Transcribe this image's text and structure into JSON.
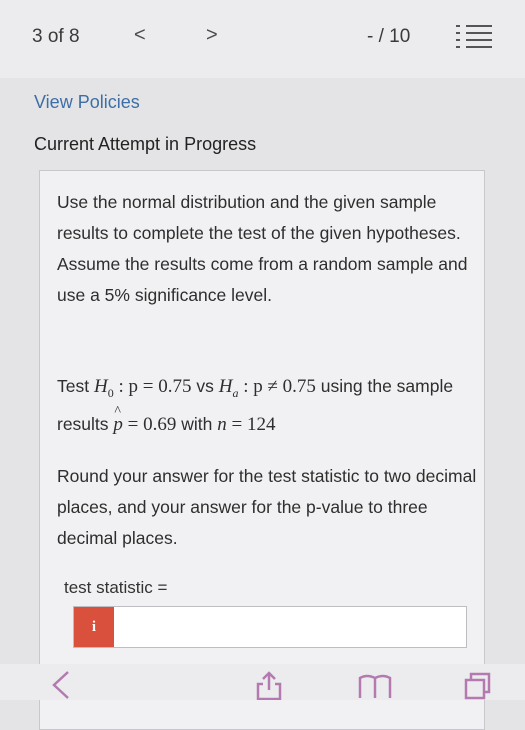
{
  "topbar": {
    "page_indicator": "3 of 8",
    "prev_symbol": "<",
    "next_symbol": ">",
    "score": "- / 10"
  },
  "links": {
    "view_policies": "View Policies"
  },
  "heading": {
    "attempt": "Current Attempt in Progress"
  },
  "question": {
    "instructions": "Use the normal distribution and the given sample results to complete the test of the given hypotheses. Assume the results come from a random sample and use a 5% significance level.",
    "test_prefix": "Test",
    "h0": "p = 0.75",
    "vs": "vs",
    "ha": "p ≠ 0.75",
    "using": "using the sample results",
    "phat_value": "= 0.69",
    "with": "with",
    "n_value": "= 124",
    "rounding": "Round your answer for the test statistic to two decimal places, and your answer for the p-value to three decimal places."
  },
  "answer": {
    "label": "test statistic =",
    "info_button": "i",
    "value": ""
  }
}
